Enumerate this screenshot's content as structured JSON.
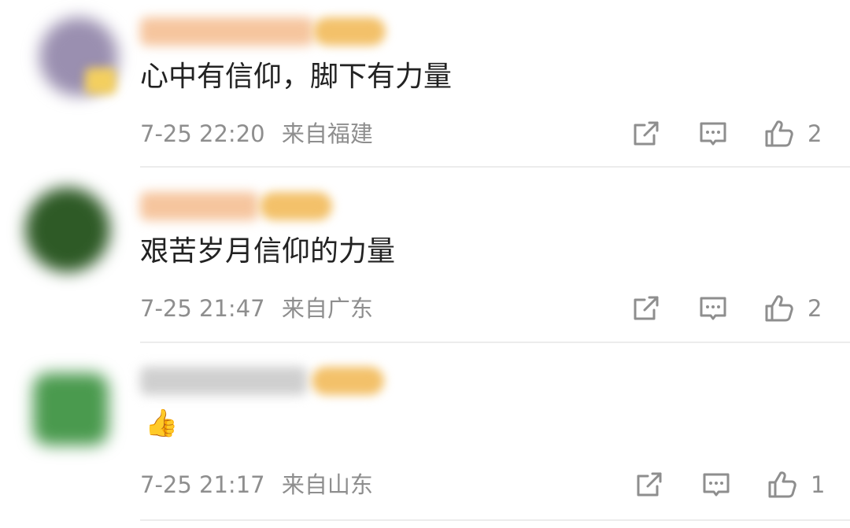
{
  "comments": [
    {
      "text": "心中有信仰，脚下有力量",
      "time": "7-25 22:20",
      "location": "来自福建",
      "likes": "2",
      "avatar_color": "#9a8fb0",
      "avatar_badge_color": "#f3cf5f",
      "name_color": "#f6c59e",
      "badge_color": "#f3c16a",
      "icons": [
        "share-icon",
        "comment-icon",
        "like-icon"
      ]
    },
    {
      "text": "艰苦岁月信仰的力量",
      "time": "7-25 21:47",
      "location": "来自广东",
      "likes": "2",
      "avatar_color": "#2e5a26",
      "name_color": "#f6c59e",
      "badge_color": "#f3c16a",
      "icons": [
        "share-icon",
        "comment-icon",
        "like-icon"
      ]
    },
    {
      "text": "",
      "emoji": "👍",
      "time": "7-25 21:17",
      "location": "来自山东",
      "likes": "1",
      "avatar_color": "#4a9a4e",
      "name_color": "#cfcfcf",
      "badge_color": "#f3c16a",
      "icons": [
        "share-icon",
        "comment-icon",
        "like-icon"
      ]
    }
  ]
}
